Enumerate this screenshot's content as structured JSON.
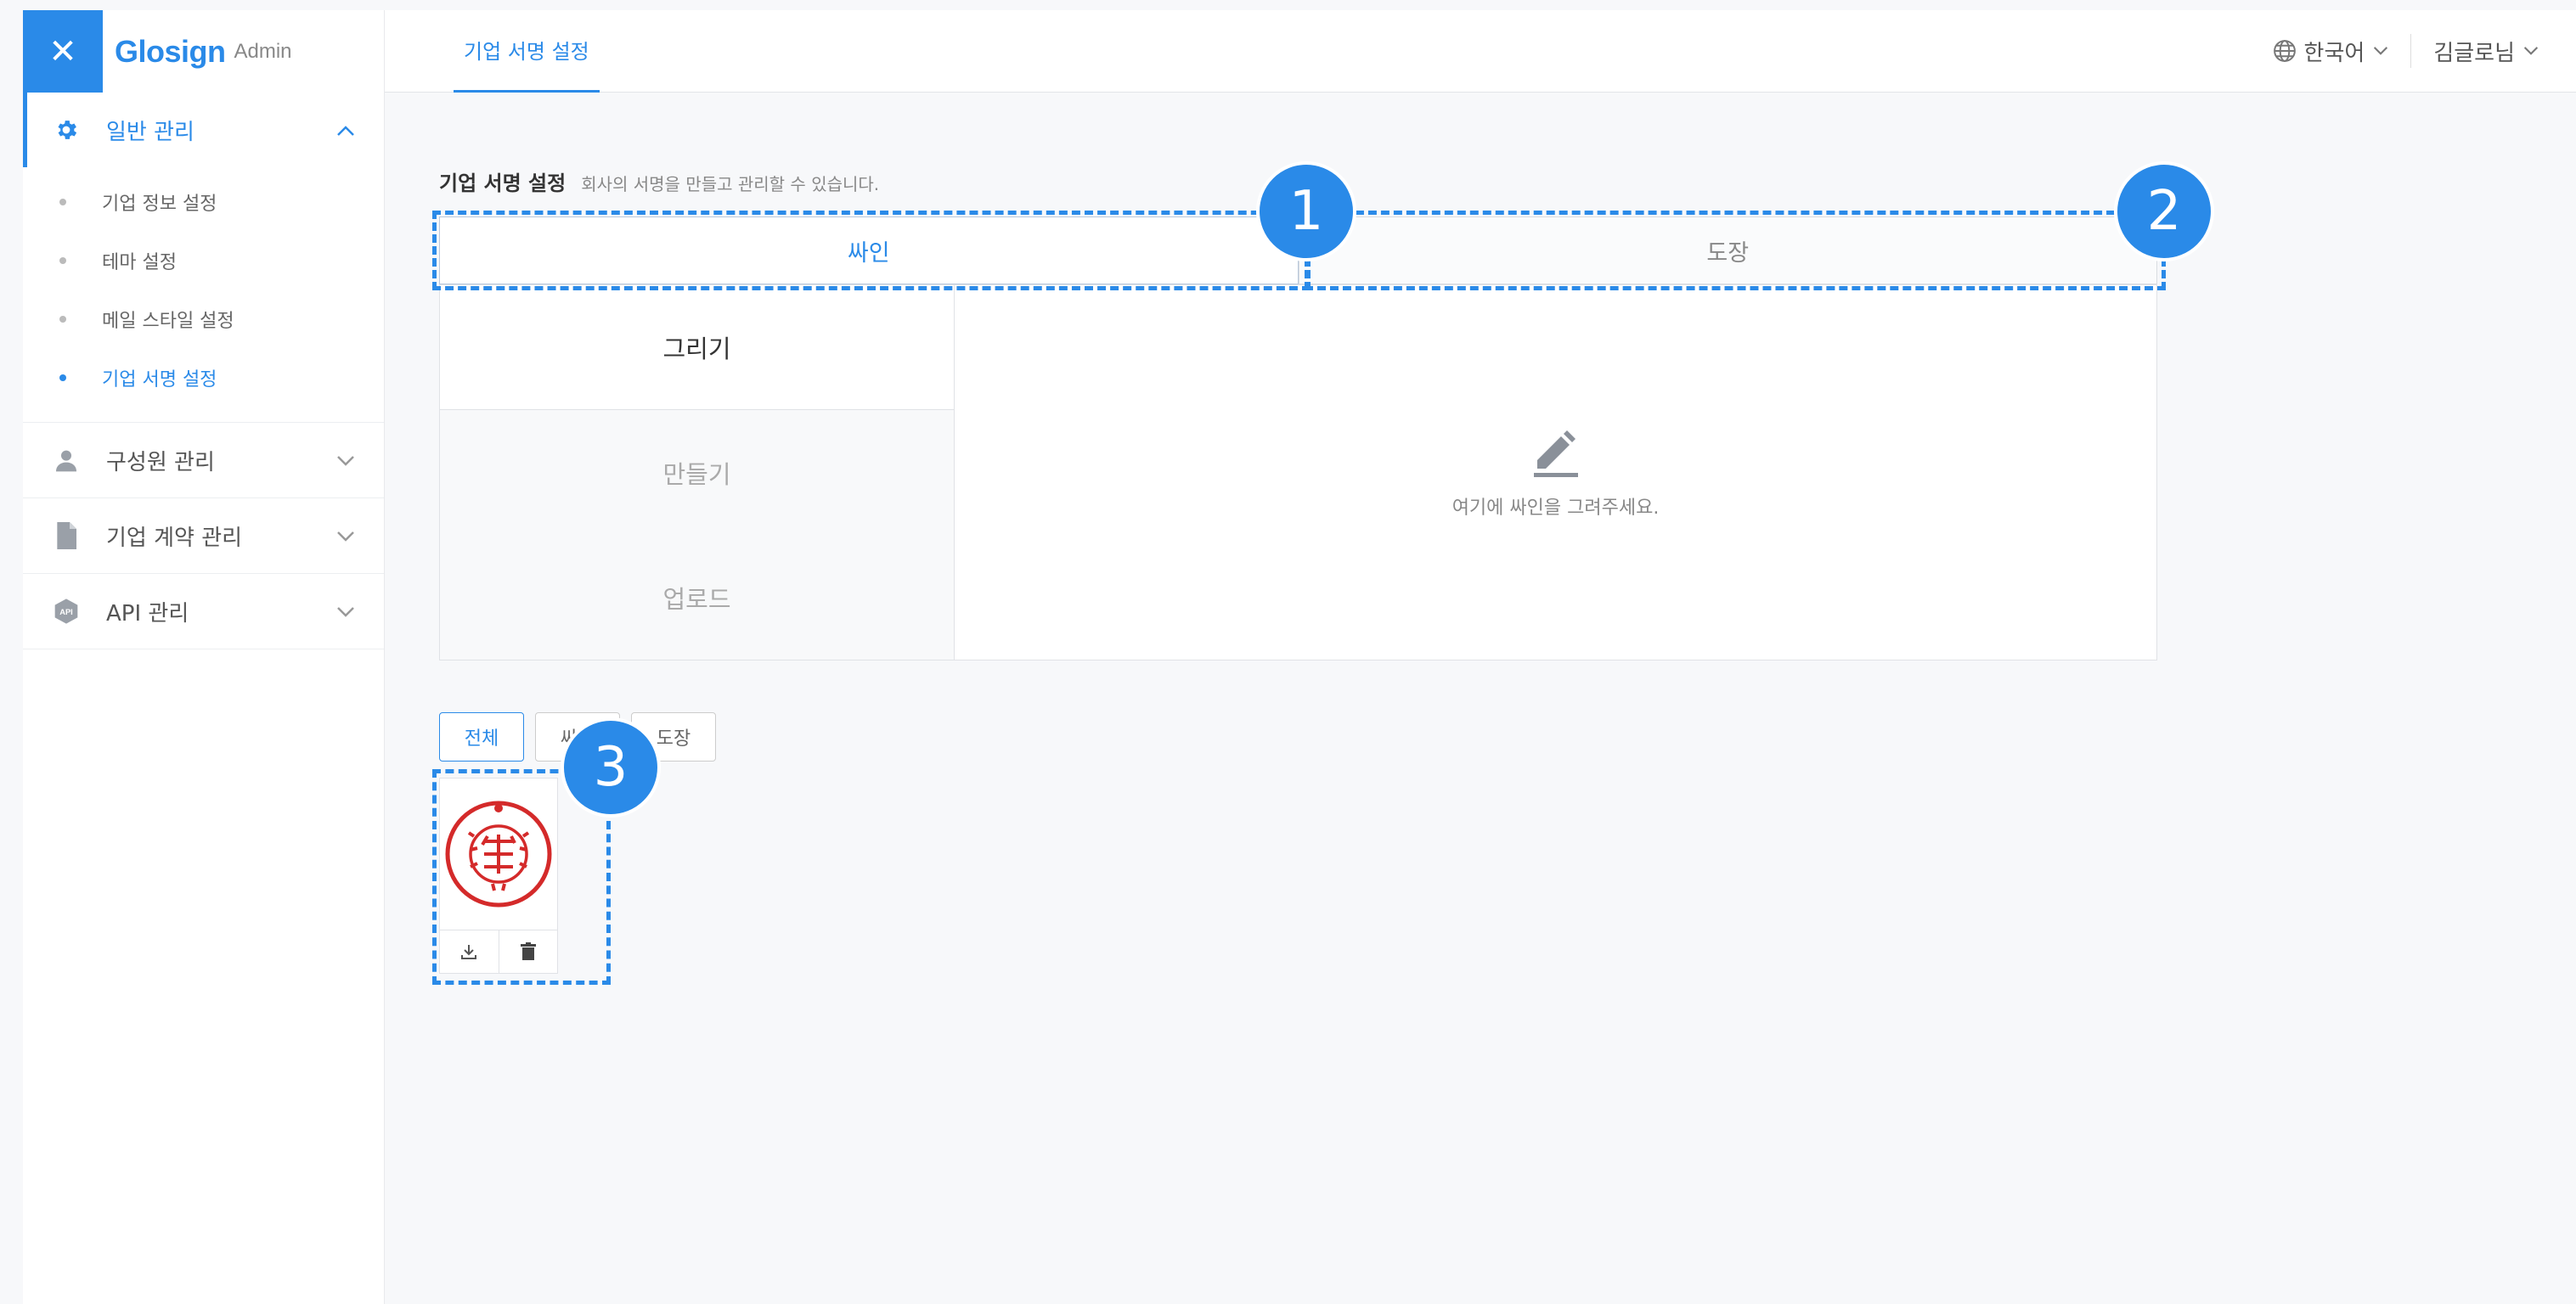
{
  "brand": {
    "name": "Glosign",
    "sub": "Admin",
    "close_icon": "close-icon"
  },
  "sidebar": {
    "groups": [
      {
        "label": "일반 관리",
        "icon": "gear-icon",
        "expanded": true,
        "items": [
          {
            "label": "기업 정보 설정"
          },
          {
            "label": "테마 설정"
          },
          {
            "label": "메일 스타일 설정"
          },
          {
            "label": "기업 서명 설정",
            "active": true
          }
        ]
      },
      {
        "label": "구성원 관리",
        "icon": "user-icon"
      },
      {
        "label": "기업 계약 관리",
        "icon": "document-icon"
      },
      {
        "label": "API 관리",
        "icon": "api-icon"
      }
    ]
  },
  "topbar": {
    "tab": "기업 서명 설정",
    "language": "한국어",
    "user": "김글로님"
  },
  "main": {
    "title": "기업 서명 설정",
    "description": "회사의 서명을 만들고 관리할 수 있습니다.",
    "tabs": [
      {
        "label": "싸인",
        "active": true
      },
      {
        "label": "도장"
      }
    ],
    "modes": [
      {
        "label": "그리기",
        "active": true
      },
      {
        "label": "만들기"
      },
      {
        "label": "업로드"
      }
    ],
    "draw_hint": "여기에 싸인을 그려주세요.",
    "filters": [
      {
        "label": "전체",
        "active": true
      },
      {
        "label": "싸인"
      },
      {
        "label": "도장"
      }
    ]
  },
  "annotations": [
    "1",
    "2",
    "3"
  ],
  "colors": {
    "accent": "#2a8ae8",
    "stamp": "#d42a2a"
  }
}
